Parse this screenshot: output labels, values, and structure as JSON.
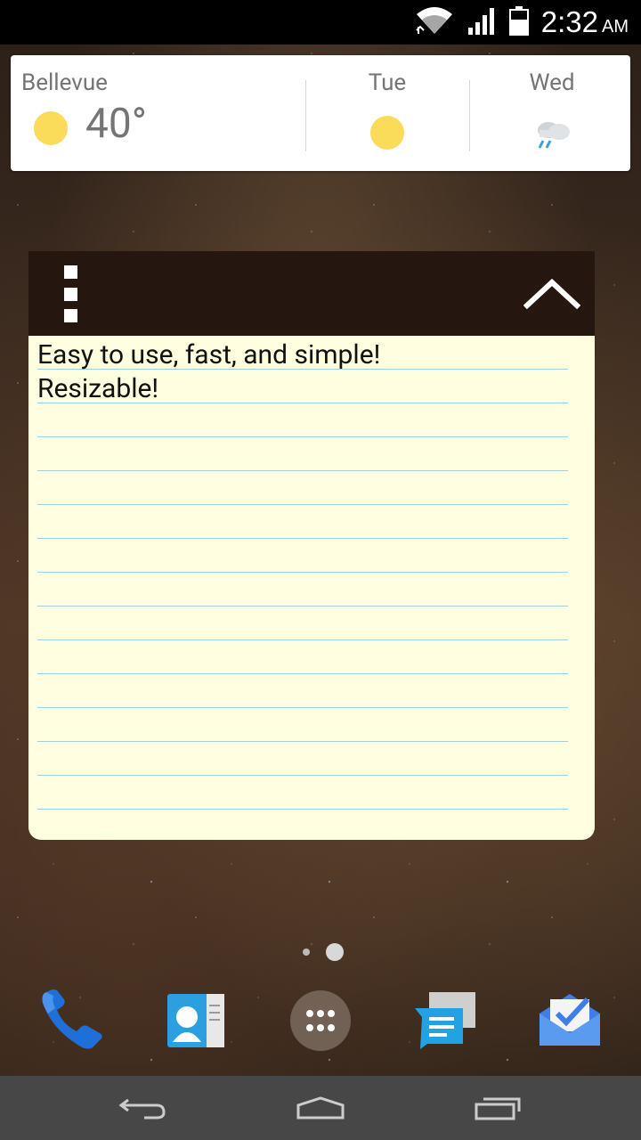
{
  "status_bar": {
    "time": "2:32",
    "ampm": "AM",
    "icons": [
      "wifi-icon",
      "signal-icon",
      "battery-icon"
    ]
  },
  "weather": {
    "city": "Bellevue",
    "temperature": "40°",
    "current_icon": "sun-icon",
    "forecast": [
      {
        "day": "Tue",
        "icon": "sun-icon"
      },
      {
        "day": "Wed",
        "icon": "rain-cloud-icon"
      }
    ],
    "colors": {
      "sun": "#fbdb5a",
      "text": "#757575"
    }
  },
  "note": {
    "lines": [
      "Easy to use, fast, and simple!",
      "Resizable!"
    ],
    "header_color": "#25170f",
    "paper_color": "#fffee1",
    "rule_color": "#9fd0dc"
  },
  "dock": {
    "apps": [
      "phone-icon",
      "contacts-icon",
      "app-drawer-icon",
      "messenger-icon",
      "inbox-icon"
    ]
  },
  "navigation": {
    "buttons": [
      "back-icon",
      "home-icon",
      "recents-icon"
    ]
  }
}
